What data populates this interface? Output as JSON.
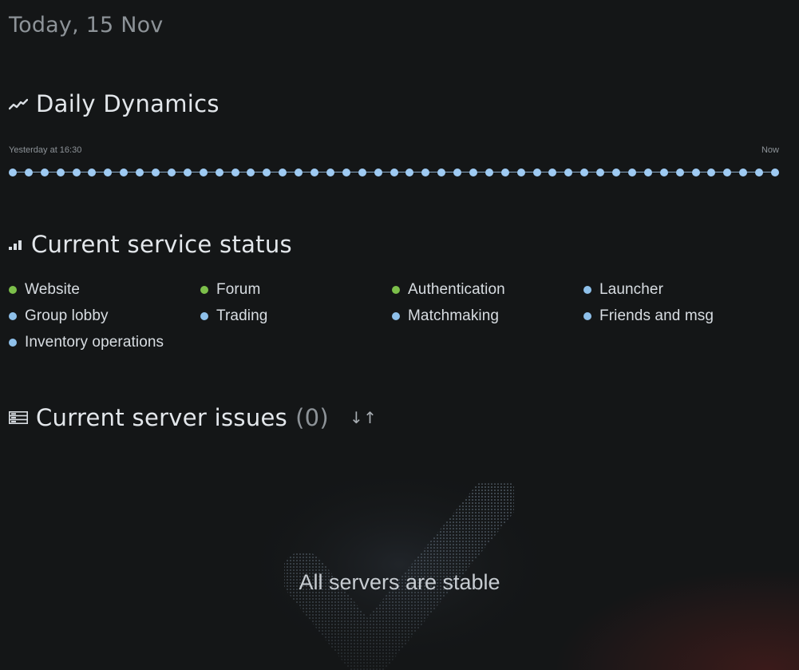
{
  "header": {
    "date": "Today, 15 Nov"
  },
  "dynamics": {
    "title": "Daily Dynamics",
    "icon": "trend-line-icon",
    "start_label": "Yesterday at 16:30",
    "end_label": "Now",
    "point_count": 49,
    "point_color": "#9ecaf2"
  },
  "service_status": {
    "title": "Current service status",
    "icon": "signal-bars-icon",
    "status_colors": {
      "online": "#7cbf4a",
      "info": "#8ec0ea"
    },
    "items": [
      {
        "label": "Website",
        "status": "online"
      },
      {
        "label": "Forum",
        "status": "online"
      },
      {
        "label": "Authentication",
        "status": "online"
      },
      {
        "label": "Launcher",
        "status": "info"
      },
      {
        "label": "Group lobby",
        "status": "info"
      },
      {
        "label": "Trading",
        "status": "info"
      },
      {
        "label": "Matchmaking",
        "status": "info"
      },
      {
        "label": "Friends and msg",
        "status": "info"
      },
      {
        "label": "Inventory operations",
        "status": "info"
      }
    ]
  },
  "server_issues": {
    "title": "Current server issues",
    "count": "(0)",
    "icon": "server-list-icon",
    "sort_icon": "↓↑",
    "empty_text": "All servers are stable"
  }
}
